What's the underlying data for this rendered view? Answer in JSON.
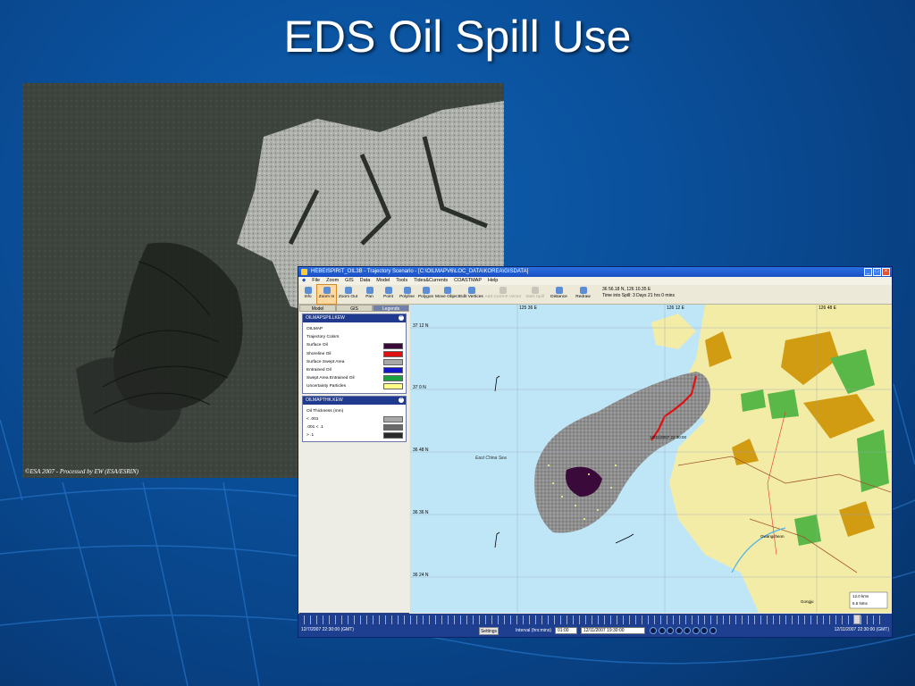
{
  "slide": {
    "title": "EDS Oil Spill Use"
  },
  "satellite": {
    "credit": "©ESA 2007 - Processed by EW (ESA/ESRIN)"
  },
  "window": {
    "title": "HEBEISPIRIT_OIL3B - Trajectory Scenario - [C:\\OILMAPV6\\LOC_DATA\\KOREA\\GISDATA]",
    "menu": [
      "File",
      "Zoom",
      "GIS",
      "Data",
      "Model",
      "Tools",
      "Tides&Currents",
      "COASTMAP",
      "Help"
    ],
    "toolbar": [
      {
        "label": "Info",
        "icon": "info-icon",
        "state": "normal"
      },
      {
        "label": "Zoom In",
        "icon": "zoom-in-icon",
        "state": "active"
      },
      {
        "label": "Zoom Out",
        "icon": "zoom-out-icon",
        "state": "normal"
      },
      {
        "label": "Pan",
        "icon": "hand-icon",
        "state": "normal"
      },
      {
        "label": "Point",
        "icon": "point-icon",
        "state": "normal"
      },
      {
        "label": "Polyline",
        "icon": "polyline-icon",
        "state": "normal"
      },
      {
        "label": "Polygon",
        "icon": "polygon-icon",
        "state": "normal"
      },
      {
        "label": "Move Object",
        "icon": "move-icon",
        "state": "normal"
      },
      {
        "label": "Edit Vertices",
        "icon": "edit-vertices-icon",
        "state": "normal"
      },
      {
        "label": "Add Current Vector",
        "icon": "current-vector-icon",
        "state": "disabled"
      },
      {
        "label": "Start Spill",
        "icon": "spill-icon",
        "state": "disabled"
      },
      {
        "label": "Distance",
        "icon": "distance-icon",
        "state": "normal"
      },
      {
        "label": "Redraw",
        "icon": "redraw-icon",
        "state": "normal"
      }
    ],
    "status": {
      "coords": "36 56.18 N,  126 10.35 E",
      "time_into_spill": "Time into Spill: 3 Days 21 hrs 0 mins"
    },
    "tabs": [
      "Model",
      "GIS",
      "Legends"
    ],
    "active_tab": "Legends",
    "legend_spill": {
      "header": "OILMAPSPILLKEW",
      "subheader": "OILMAP",
      "section": "Trajectory Colors",
      "items": [
        {
          "label": "Surface Oil",
          "color": "#3a0a3a"
        },
        {
          "label": "Shoreline Oil",
          "color": "#e01010"
        },
        {
          "label": "Surface Swept Area",
          "color": "#a8a8a8"
        },
        {
          "label": "Entrained Oil",
          "color": "#1515c8"
        },
        {
          "label": "Swept Area Entrained Oil",
          "color": "#1aa040"
        },
        {
          "label": "Uncertainty Particles",
          "color": "#ffff88"
        }
      ]
    },
    "legend_thickness": {
      "header": "OILMAPTHK.KEW",
      "section": "Oil Thickness (mm)",
      "items": [
        {
          "label": "<  .001",
          "color": "#a8a8a8"
        },
        {
          "label": ".001 <  .1",
          "color": "#6a6a6a"
        },
        {
          "label": ">  .1",
          "color": "#2a2a2a"
        }
      ]
    },
    "map": {
      "lon_labels": [
        "125 36 E",
        "126 12 E",
        "126 48 E"
      ],
      "lat_labels": [
        "37 12 N",
        "37 0 N",
        "36 48 N",
        "36 36 N",
        "36 24 N"
      ],
      "sea_label": "East China Sea",
      "place_labels": [
        "Gwangcheon",
        "Gongju"
      ],
      "scale_km": "12.0 kms",
      "scale_nm": "6.5 Nms",
      "spill_time_label": "12/11/2007 22:30:00"
    },
    "timeline": {
      "start": "12/7/2007 22:30:00 (GMT)",
      "end": "12/11/2007 22:30:00 (GMT)",
      "settings": "Settings",
      "interval_label": "Interval (hrs:mins)",
      "interval_value": "01:00",
      "current_time": "12/11/2007 19:30:00",
      "position_fraction": 0.95
    }
  },
  "colors": {
    "slide_bg": "#0a4f9a",
    "sea": "#bfe6f7",
    "land": "#f3eca6",
    "forest": "#59b847",
    "urban": "#d19b12",
    "surface_oil": "#3a0a3a",
    "shoreline_oil": "#e01010"
  }
}
